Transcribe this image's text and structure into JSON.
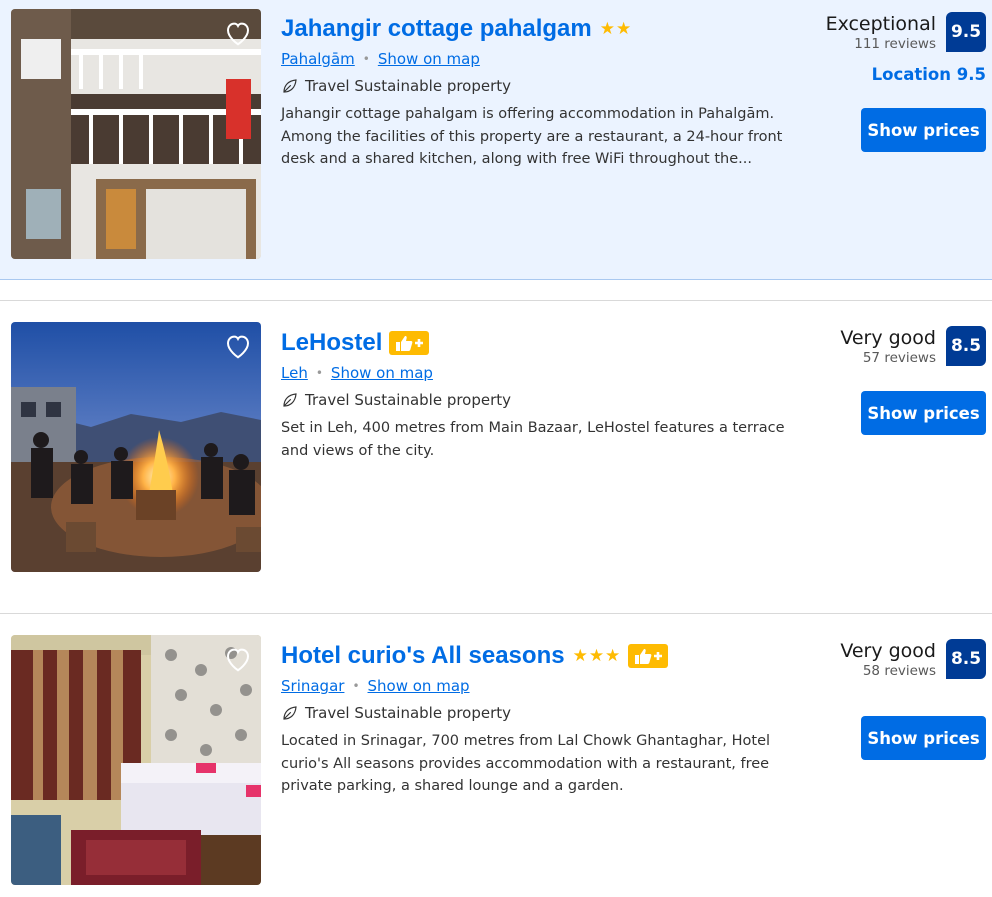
{
  "colors": {
    "accent": "#006ce4",
    "score_badge": "#003b95",
    "star": "#febb02",
    "highlight_bg": "#ebf3ff"
  },
  "listings": [
    {
      "title": "Jahangir cottage pahalgam",
      "stars": "★★",
      "has_thumb_badge": false,
      "location": "Pahalgām",
      "show_on_map": "Show on map",
      "sustainable": "Travel Sustainable property",
      "description": "Jahangir cottage pahalgam is offering accommodation in Pahalgām. Among the facilities of this property are a restaurant, a 24-hour front desk and a shared kitchen, along with free WiFi throughout the...",
      "review_word": "Exceptional",
      "reviews": "111 reviews",
      "score": "9.5",
      "location_score": "Location 9.5",
      "button": "Show prices"
    },
    {
      "title": "LeHostel",
      "stars": "",
      "has_thumb_badge": true,
      "location": "Leh",
      "show_on_map": "Show on map",
      "sustainable": "Travel Sustainable property",
      "description": "Set in Leh, 400 metres from Main Bazaar, LeHostel features a terrace and views of the city.",
      "review_word": "Very good",
      "reviews": "57 reviews",
      "score": "8.5",
      "button": "Show prices"
    },
    {
      "title": "Hotel curio's All seasons",
      "stars": "★★★",
      "has_thumb_badge": true,
      "location": "Srinagar",
      "show_on_map": "Show on map",
      "sustainable": "Travel Sustainable property",
      "description": "Located in Srinagar, 700 metres from Lal Chowk Ghantaghar, Hotel curio's All seasons provides accommodation with a restaurant, free private parking, a shared lounge and a garden.",
      "review_word": "Very good",
      "reviews": "58 reviews",
      "score": "8.5",
      "button": "Show prices"
    }
  ]
}
